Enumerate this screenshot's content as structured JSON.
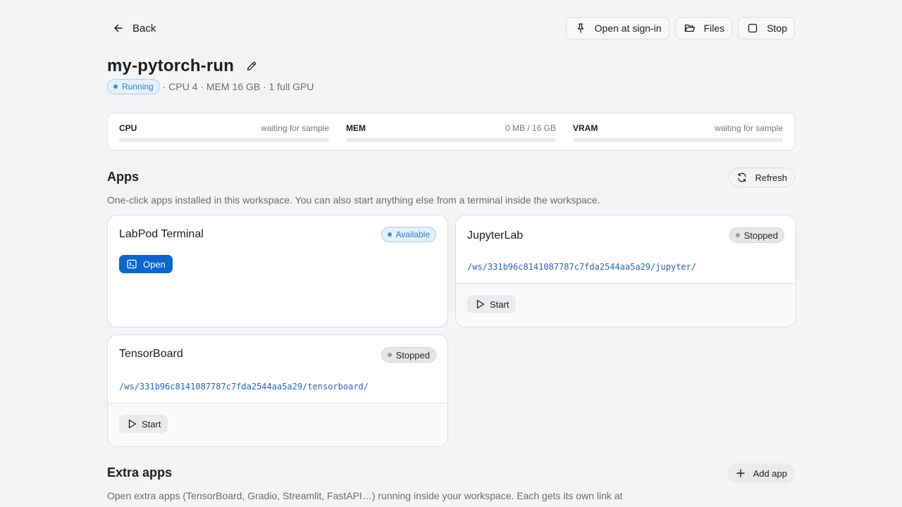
{
  "topbar": {
    "back_label": "Back",
    "open_at_signin_label": "Open at sign-in",
    "files_label": "Files",
    "stop_label": "Stop"
  },
  "workspace": {
    "name": "my-pytorch-run",
    "status": "Running",
    "specs": "· CPU 4 · MEM 16 GB · 1 full GPU"
  },
  "metrics": [
    {
      "label": "CPU",
      "value": "waiting for sample",
      "fill": 0
    },
    {
      "label": "MEM",
      "value": "0 MB / 16 GB",
      "fill": 0
    },
    {
      "label": "VRAM",
      "value": "waiting for sample",
      "fill": 0
    }
  ],
  "apps": {
    "title": "Apps",
    "description": "One-click apps installed in this workspace. You can also start anything else from a terminal inside the workspace.",
    "refresh_label": "Refresh",
    "items": [
      {
        "name": "LabPod Terminal",
        "status": "Available",
        "action": "Open"
      },
      {
        "name": "JupyterLab",
        "status": "Stopped",
        "path": "/ws/331b96c8141087787c7fda2544aa5a29/jupyter/",
        "action": "Start"
      },
      {
        "name": "TensorBoard",
        "status": "Stopped",
        "path": "/ws/331b96c8141087787c7fda2544aa5a29/tensorboard/",
        "action": "Start"
      }
    ]
  },
  "extra_apps": {
    "title": "Extra apps",
    "description": "Open extra apps (TensorBoard, Gradio, Streamlit, FastAPI…) running inside your workspace. Each gets its own link at",
    "add_label": "Add app"
  },
  "colors": {
    "accent": "#0a66d0",
    "status_available": "#3a8ee0",
    "status_stopped": "#9a9a9e",
    "background": "#f4f4f6"
  }
}
